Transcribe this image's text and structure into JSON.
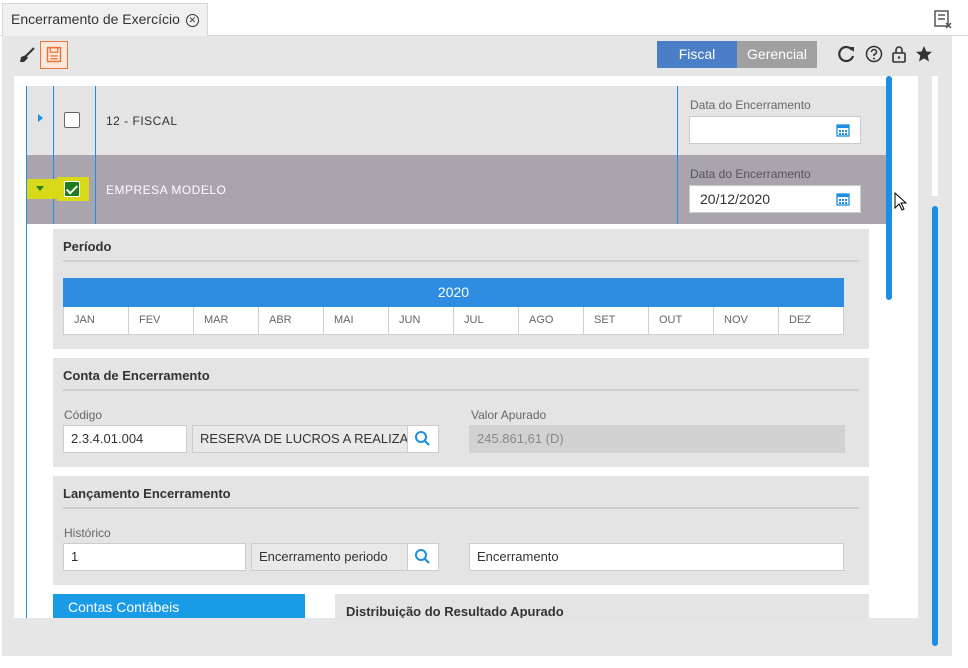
{
  "tab": {
    "title": "Encerramento de Exercício",
    "close_symbol": "✕"
  },
  "toolbar": {
    "modes": [
      {
        "label": "Fiscal",
        "active": true
      },
      {
        "label": "Gerencial",
        "active": false
      }
    ]
  },
  "rows": [
    {
      "name": "12 - FISCAL",
      "checked": false,
      "date_label": "Data do Encerramento",
      "date_value": ""
    },
    {
      "name": "EMPRESA MODELO",
      "checked": true,
      "date_label": "Data do Encerramento",
      "date_value": "20/12/2020"
    }
  ],
  "periodo": {
    "title": "Período",
    "year": "2020",
    "months": [
      "JAN",
      "FEV",
      "MAR",
      "ABR",
      "MAI",
      "JUN",
      "JUL",
      "AGO",
      "SET",
      "OUT",
      "NOV",
      "DEZ"
    ]
  },
  "conta": {
    "title": "Conta de Encerramento",
    "codigo_label": "Código",
    "codigo_value": "2.3.4.01.004",
    "descricao_value": "RESERVA DE LUCROS A REALIZAR",
    "valor_label": "Valor Apurado",
    "valor_value": "245.861,61 (D)"
  },
  "lancamento": {
    "title": "Lançamento Encerramento",
    "historico_label": "Histórico",
    "historico_value": "1",
    "historico_desc": "Encerramento periodo",
    "complemento_value": "Encerramento"
  },
  "bottom": {
    "contas_label": "Contas Contábeis",
    "distribuicao_label": "Distribuição do Resultado Apurado"
  },
  "colors": {
    "accent": "#1a8fe3",
    "fiscal": "#4a7fc8",
    "selected_row": "#a9a4ad",
    "save_border": "#e8743b"
  }
}
